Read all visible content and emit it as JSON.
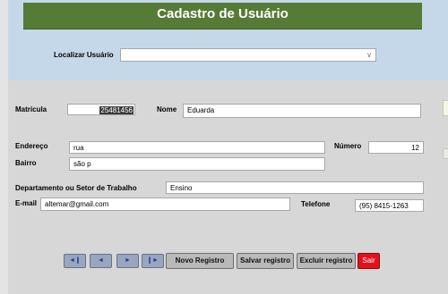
{
  "form": {
    "title": "Cadastro de Usuário",
    "search": {
      "label": "Localizar Usuário",
      "value": ""
    },
    "fields": {
      "matricula": {
        "label": "Matrícula",
        "value": "25481456"
      },
      "nome": {
        "label": "Nome",
        "value": "Eduarda"
      },
      "endereco": {
        "label": "Endereço",
        "value": "rua"
      },
      "numero": {
        "label": "Número",
        "value": "12"
      },
      "bairro": {
        "label": "Bairro",
        "value": "são p"
      },
      "departamento": {
        "label": "Departamento ou Setor de Trabalho",
        "value": "Ensino"
      },
      "email": {
        "label": "E-mail",
        "value": "altemar@gmail.com"
      },
      "telefone": {
        "label": "Telefone",
        "value": "(95) 8415-1263"
      }
    },
    "buttons": {
      "first": "◄❙",
      "prev": "◄",
      "next": "►",
      "last": "❙►",
      "new": "Novo Registro",
      "save": "Salvar registro",
      "delete": "Excluir registro",
      "exit": "Sair"
    }
  },
  "colors": {
    "title_bar": "#557b36",
    "header_bg": "#c5d8ea",
    "body_bg": "#d7d7d7",
    "exit_button": "#e1121d"
  }
}
